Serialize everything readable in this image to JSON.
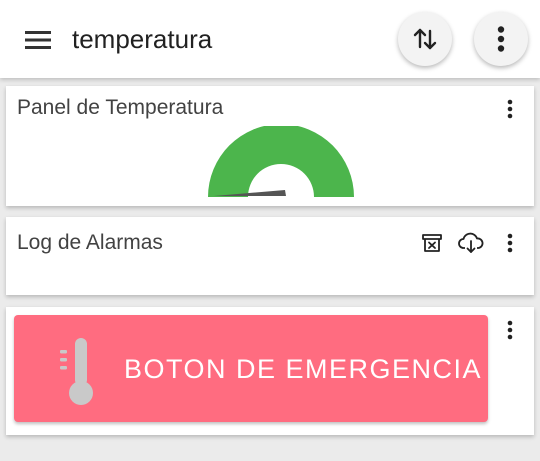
{
  "appbar": {
    "title": "temperatura",
    "menu_icon": "hamburger-menu-icon",
    "sort_icon": "sort-arrows-icon",
    "more_icon": "more-vert-icon"
  },
  "cards": {
    "temperature_panel": {
      "title": "Panel de Temperatura",
      "gauge": {
        "value_fraction": 0.02,
        "arc_color": "#4cb54c",
        "needle_color": "#555555"
      }
    },
    "alarm_log": {
      "title": "Log de Alarmas",
      "clear_icon": "archive-clear-icon",
      "download_icon": "cloud-download-icon"
    },
    "emergency": {
      "label": "BOTON DE EMERGENCIA",
      "icon": "thermometer-icon",
      "color": "#ff6c80"
    }
  }
}
